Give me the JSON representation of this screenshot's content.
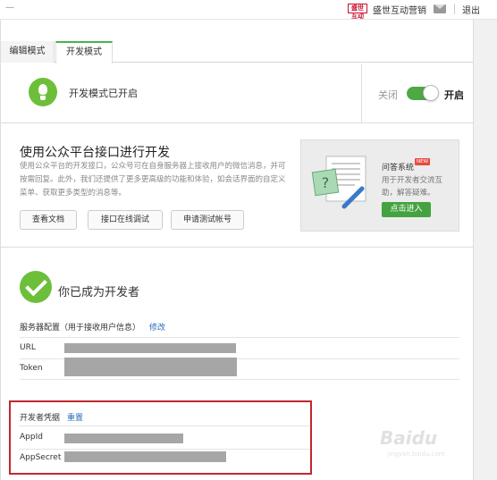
{
  "topbar": {
    "dash": "—",
    "brand_logo": "盛世互动",
    "brand_name": "盛世互动营销",
    "logout": "退出"
  },
  "tabs": [
    {
      "label": "编辑模式",
      "active": false
    },
    {
      "label": "开发模式",
      "active": true
    }
  ],
  "status": {
    "text": "开发模式已开启",
    "toggle_off_label": "关闭",
    "toggle_on_label": "开启",
    "enabled": true
  },
  "api": {
    "title": "使用公众平台接口进行开发",
    "description": "使用公众平台的开发接口，公众号可在自身服务器上接收用户的微信消息，并可按需回复。此外，我们还提供了更多更高级的功能和体验，如会话界面的自定义菜单、获取更多类型的消息等。",
    "buttons": {
      "docs": "查看文档",
      "debug": "接口在线调试",
      "apply": "申请测试帐号"
    }
  },
  "qa": {
    "title": "问答系统",
    "new_badge": "NEW",
    "description": "用于开发者交流互助，解答疑难。",
    "button": "点击进入"
  },
  "developer": {
    "title": "你已成为开发者",
    "server_label": "服务器配置（用于接收用户信息）",
    "server_edit": "修改",
    "url_label": "URL",
    "token_label": "Token",
    "cred_label": "开发者凭据",
    "cred_reset": "重置",
    "appid_label": "AppId",
    "appsecret_label": "AppSecret"
  },
  "watermark": {
    "main": "Baidu",
    "sub": "jingyan.baidu.com"
  },
  "colors": {
    "accent_green": "#44b549",
    "link_blue": "#2a6ebb",
    "highlight_red": "#c0282d"
  }
}
